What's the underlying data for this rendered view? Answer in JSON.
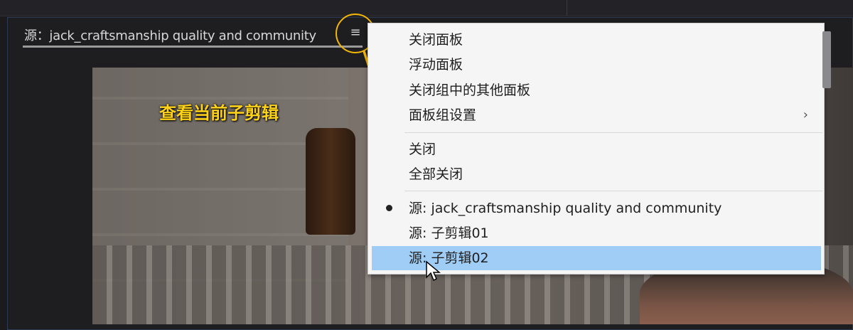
{
  "panel": {
    "title": "源：jack_craftsmanship quality and community",
    "menu_icon": "hamburger-icon"
  },
  "annotation": {
    "caption": "查看当前子剪辑",
    "accent_color": "#f2b705"
  },
  "context_menu": {
    "items": [
      {
        "label": "关闭面板"
      },
      {
        "label": "浮动面板"
      },
      {
        "label": "关闭组中的其他面板"
      },
      {
        "label": "面板组设置",
        "submenu": true,
        "chevron": "›"
      }
    ],
    "items2": [
      {
        "label": "关闭"
      },
      {
        "label": "全部关闭"
      }
    ],
    "sources": [
      {
        "label": "源: jack_craftsmanship quality and community",
        "checked": true
      },
      {
        "label": "源: 子剪辑01",
        "checked": false
      },
      {
        "label": "源: 子剪辑02",
        "checked": false,
        "highlighted": true
      }
    ],
    "highlight_color": "#9fcdf6"
  }
}
